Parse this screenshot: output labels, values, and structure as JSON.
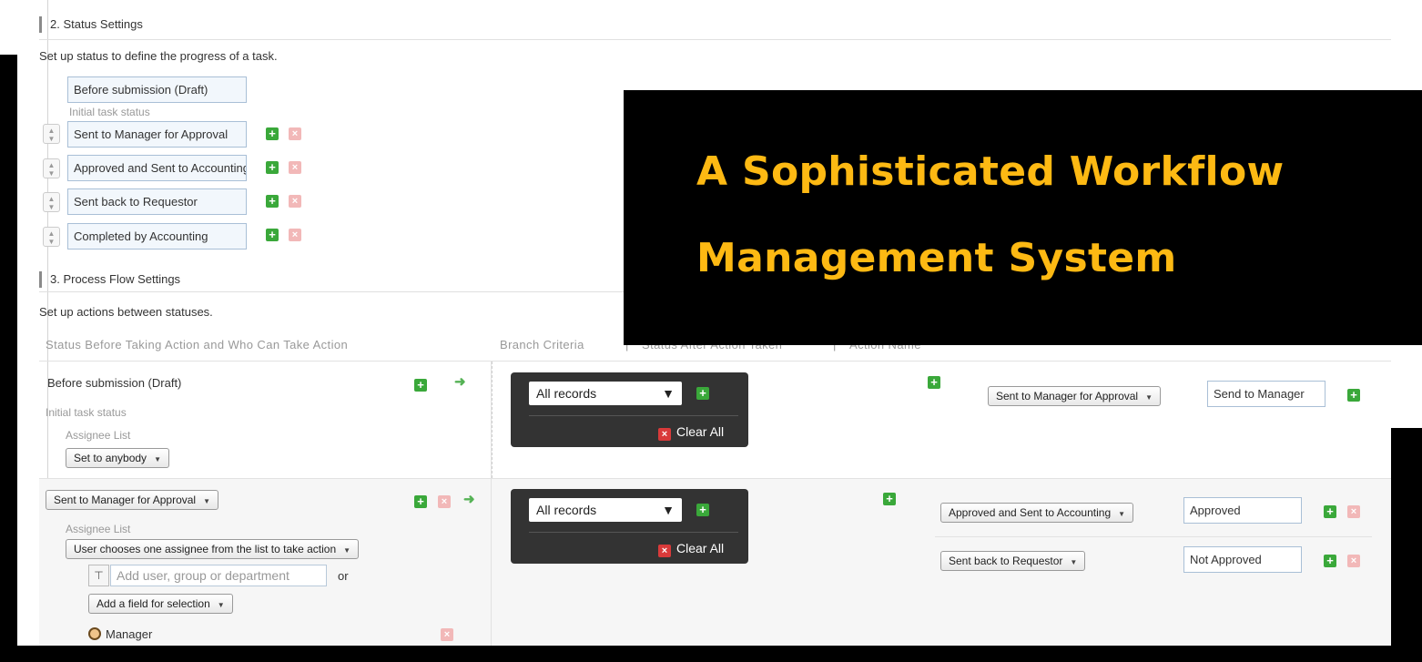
{
  "section2": {
    "title": "2. Status Settings",
    "description": "Set up status to define the progress of a task.",
    "initial_status": "Before submission (Draft)",
    "initial_hint": "Initial task status",
    "statuses": [
      "Sent to Manager for Approval",
      "Approved and Sent to Accounting",
      "Sent back to Requestor",
      "Completed by Accounting"
    ]
  },
  "section3": {
    "title": "3. Process Flow Settings",
    "description": "Set up actions between statuses.",
    "columns": {
      "status_before": "Status Before Taking Action and Who Can Take Action",
      "branch_criteria": "Branch Criteria",
      "separator": "|",
      "status_after": "Status After Action Taken",
      "action_name": "Action Name"
    },
    "rows": [
      {
        "status": "Before submission (Draft)",
        "status_hint": "Initial task status",
        "assignee_label": "Assignee List",
        "assignee_value": "Set to anybody",
        "branch": {
          "select": "All records",
          "clear": "Clear All"
        },
        "outcomes": [
          {
            "status": "Sent to Manager for Approval",
            "action": "Send to Manager"
          }
        ]
      },
      {
        "status": "Sent to Manager for Approval",
        "assignee_label": "Assignee List",
        "assignee_value": "User chooses one assignee from the list to take action",
        "user_placeholder": "Add user, group or department",
        "or_label": "or",
        "field_select": "Add a field for selection",
        "assignee_entry": "Manager",
        "branch": {
          "select": "All records",
          "clear": "Clear All"
        },
        "outcomes": [
          {
            "status": "Approved and Sent to Accounting",
            "action": "Approved"
          },
          {
            "status": "Sent back to Requestor",
            "action": "Not Approved"
          }
        ]
      }
    ]
  },
  "overlay": {
    "line1": "A Sophisticated Workflow",
    "line2": "Management System"
  },
  "icons": {
    "add": "plus-icon",
    "remove": "remove-icon",
    "arrow": "arrow-right-icon",
    "sort": "sort-handle-icon",
    "tree": "org-tree-icon",
    "user": "user-icon"
  },
  "colors": {
    "accent_add": "#3aa83a",
    "overlay_text": "#fdb913",
    "overlay_bg": "#000000",
    "branch_bg": "#333333"
  }
}
